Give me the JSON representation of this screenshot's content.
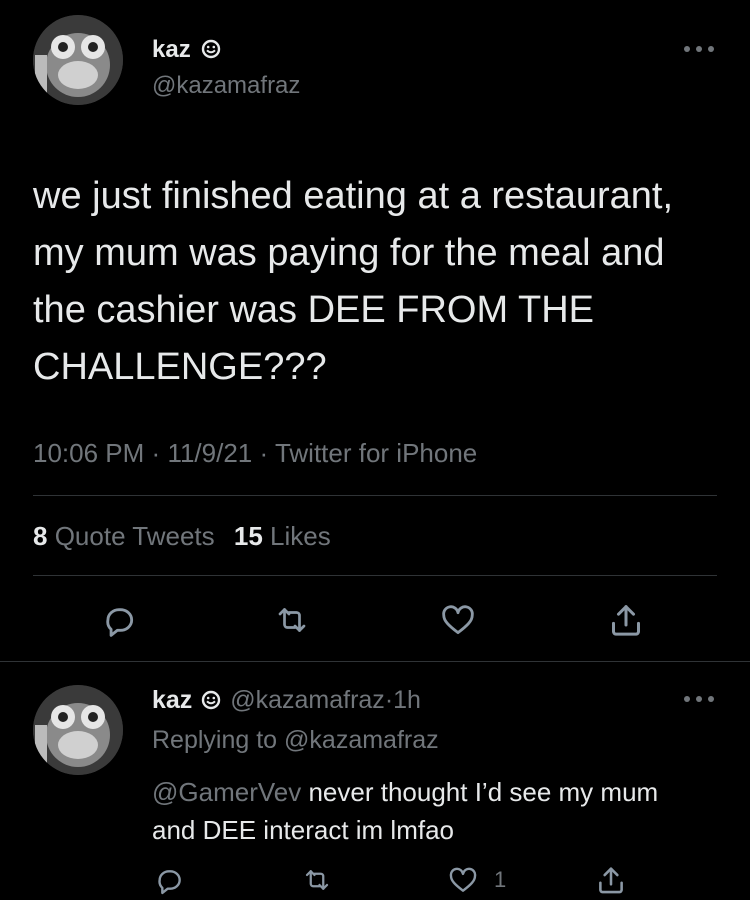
{
  "main_tweet": {
    "author_name": "kaz",
    "author_handle": "@kazamafraz",
    "text": "we just finished eating at a restaurant, my mum was paying for the meal and the cashier was DEE FROM THE CHALLENGE???",
    "time": "10:06 PM",
    "date": "11/9/21",
    "source": "Twitter for iPhone",
    "separator": "·",
    "stats": {
      "quote_count": "8",
      "quote_label": "Quote Tweets",
      "like_count": "15",
      "like_label": "Likes"
    }
  },
  "reply": {
    "author_name": "kaz",
    "author_handle": "@kazamafraz",
    "separator": "·",
    "time_ago": "1h",
    "replying_prefix": "Replying to",
    "replying_to": "@kazamafraz",
    "mention": "@GamerVev",
    "text": "never thought I’d see my mum and DEE interact im lmfao",
    "like_count": "1"
  },
  "colors": {
    "background": "#000000",
    "text": "#e7e9ea",
    "muted": "#71767b",
    "divider": "#2f3336"
  },
  "icons": [
    "avatar-monkey",
    "verified-badge-icon",
    "more-icon",
    "reply-icon",
    "retweet-icon",
    "like-icon",
    "share-icon"
  ]
}
